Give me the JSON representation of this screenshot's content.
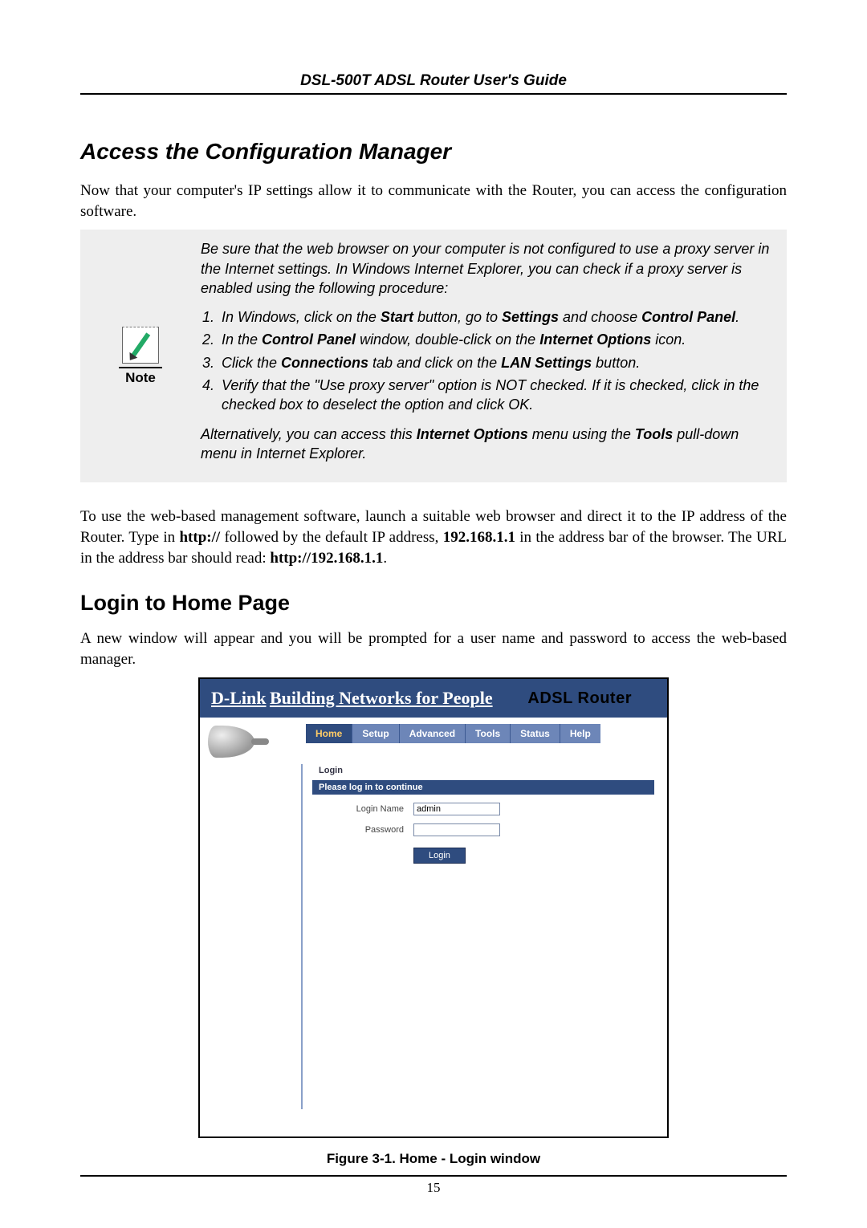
{
  "header": {
    "title": "DSL-500T ADSL Router User's Guide"
  },
  "section": {
    "title": "Access the Configuration  Manager"
  },
  "intro": "Now that your computer's IP settings allow it to communicate with the Router, you can access the configuration software.",
  "note": {
    "label": "Note",
    "preamble": "Be sure that the web browser on your computer is not configured to use a proxy server in the Internet settings. In Windows Internet Explorer, you can check if a proxy server is enabled using the following procedure:",
    "steps": [
      {
        "pre": "In Windows, click on the ",
        "bold1": "Start",
        "mid1": " button, go to ",
        "bold2": "Settings",
        "mid2": " and choose ",
        "bold3": "Control Panel",
        "post": "."
      },
      {
        "pre": "In the ",
        "bold1": "Control Panel",
        "mid1": " window, double-click on the ",
        "bold2": "Internet Options",
        "post": " icon."
      },
      {
        "pre": "Click the ",
        "bold1": "Connections",
        "mid1": " tab and click on the ",
        "bold2": "LAN Settings",
        "post": " button."
      },
      {
        "pre": "Verify that the \"Use proxy server\" option is NOT checked. If it is checked, click in the checked box to deselect the option and click OK."
      }
    ],
    "alt_pre": "Alternatively, you can access this ",
    "alt_b1": "Internet Options",
    "alt_mid": " menu using the ",
    "alt_b2": "Tools",
    "alt_post": " pull-down menu in Internet Explorer."
  },
  "para2": {
    "t1": "To use the web-based management software, launch a suitable web browser and direct it to the IP address of the Router. Type in ",
    "b1": "http://",
    "t2": " followed by the default IP address, ",
    "b2": "192.168.1.1",
    "t3": " in the address bar of the browser. The URL in the address bar should read: ",
    "b3": "http://192.168.1.1",
    "t4": "."
  },
  "subsection": {
    "title": "Login to Home Page"
  },
  "subbody": "A new window will appear and you will be prompted for a user name and password to access the web-based manager.",
  "shot": {
    "brand": "D-Link",
    "brand_tag": "Building Networks for People",
    "router_title": "ADSL Router",
    "tabs": [
      "Home",
      "Setup",
      "Advanced",
      "Tools",
      "Status",
      "Help"
    ],
    "active_tab_index": 0,
    "section_label": "Login",
    "login_bar": "Please log in to continue",
    "login_name_label": "Login Name",
    "login_name_value": "admin",
    "password_label": "Password",
    "password_value": "",
    "login_button": "Login"
  },
  "figure_caption": "Figure 3-1. Home - Login window",
  "page_number": "15"
}
